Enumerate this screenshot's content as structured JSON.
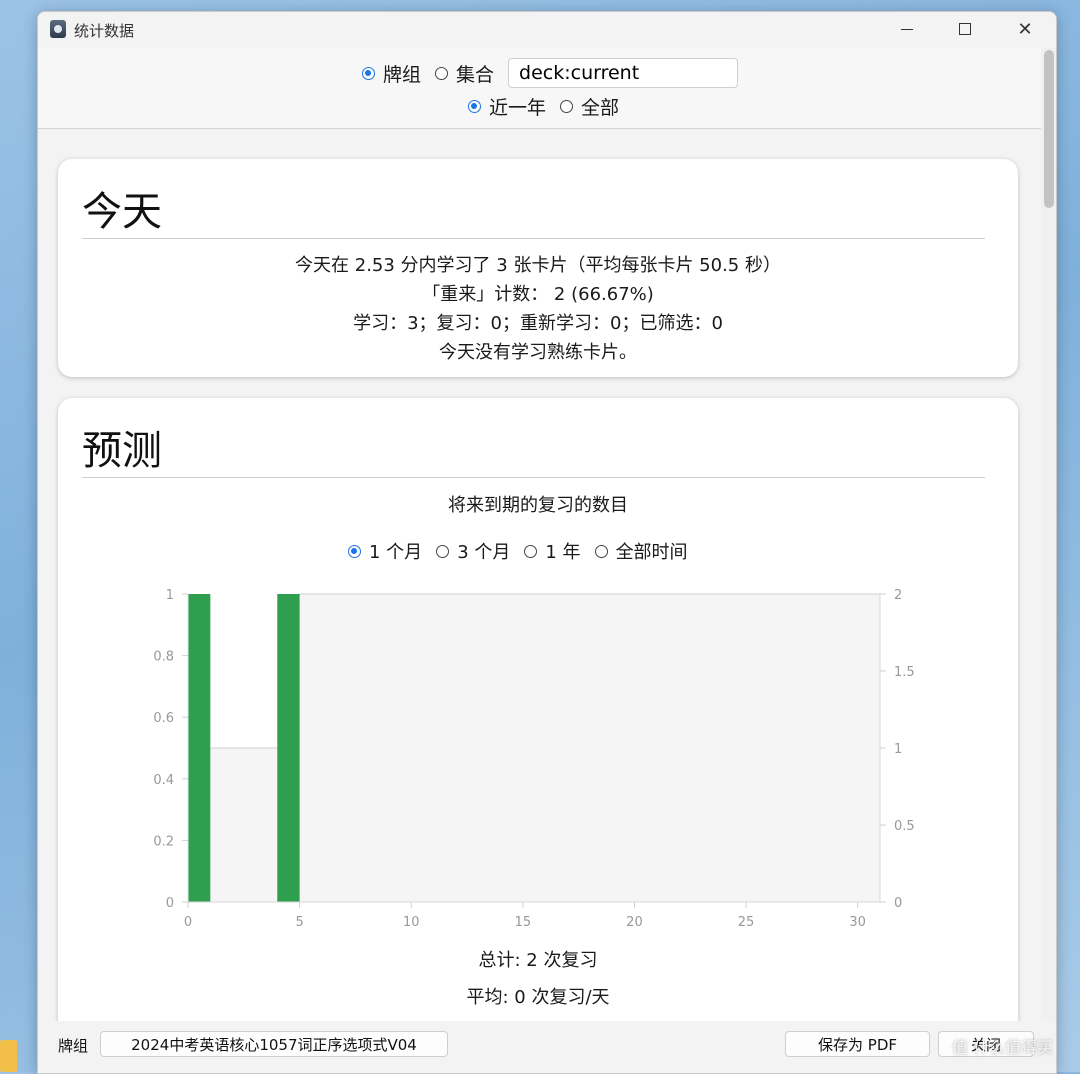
{
  "window": {
    "title": "统计数据"
  },
  "topbar": {
    "scope_deck": "牌组",
    "scope_collection": "集合",
    "search_value": "deck:current",
    "range_year": "近一年",
    "range_all": "全部"
  },
  "today": {
    "title": "今天",
    "line1": "今天在 2.53 分内学习了 3 张卡片（平均每张卡片 50.5 秒）",
    "line2": "「重来」计数： 2 (66.67%)",
    "line3": "学习：3；复习：0；重新学习：0；已筛选：0",
    "line4": "今天没有学习熟练卡片。"
  },
  "forecast": {
    "title": "预测",
    "subtitle": "将来到期的复习的数目",
    "range_options": [
      "1 个月",
      "3 个月",
      "1 年",
      "全部时间"
    ],
    "total": "总计: 2 次复习",
    "average": "平均: 0 次复习/天"
  },
  "chart_data": {
    "type": "bar",
    "x": [
      0,
      4
    ],
    "values": [
      1,
      1
    ],
    "bar_width_days": 1,
    "xlim": [
      0,
      31
    ],
    "ylim": [
      0,
      1
    ],
    "y2lim": [
      0,
      2
    ],
    "x_ticks": [
      "0",
      "5",
      "10",
      "15",
      "20",
      "25",
      "30"
    ],
    "y_ticks": [
      "0",
      "0.2",
      "0.4",
      "0.6",
      "0.8",
      "1"
    ],
    "y2_ticks": [
      "0",
      "0.5",
      "1",
      "1.5",
      "2"
    ],
    "cumulative": {
      "x": [
        0,
        1,
        4,
        5,
        31
      ],
      "y": [
        0,
        1,
        1,
        2,
        2
      ]
    },
    "bar_color": "#2e9e4f",
    "area_color": "#f5f5f5",
    "grid": false
  },
  "bottombar": {
    "deck_label": "牌组",
    "deck_name": "2024中考英语核心1057词正序选项式V04",
    "save_pdf": "保存为 PDF",
    "close": "关闭"
  },
  "watermark": "值 什么值得买"
}
